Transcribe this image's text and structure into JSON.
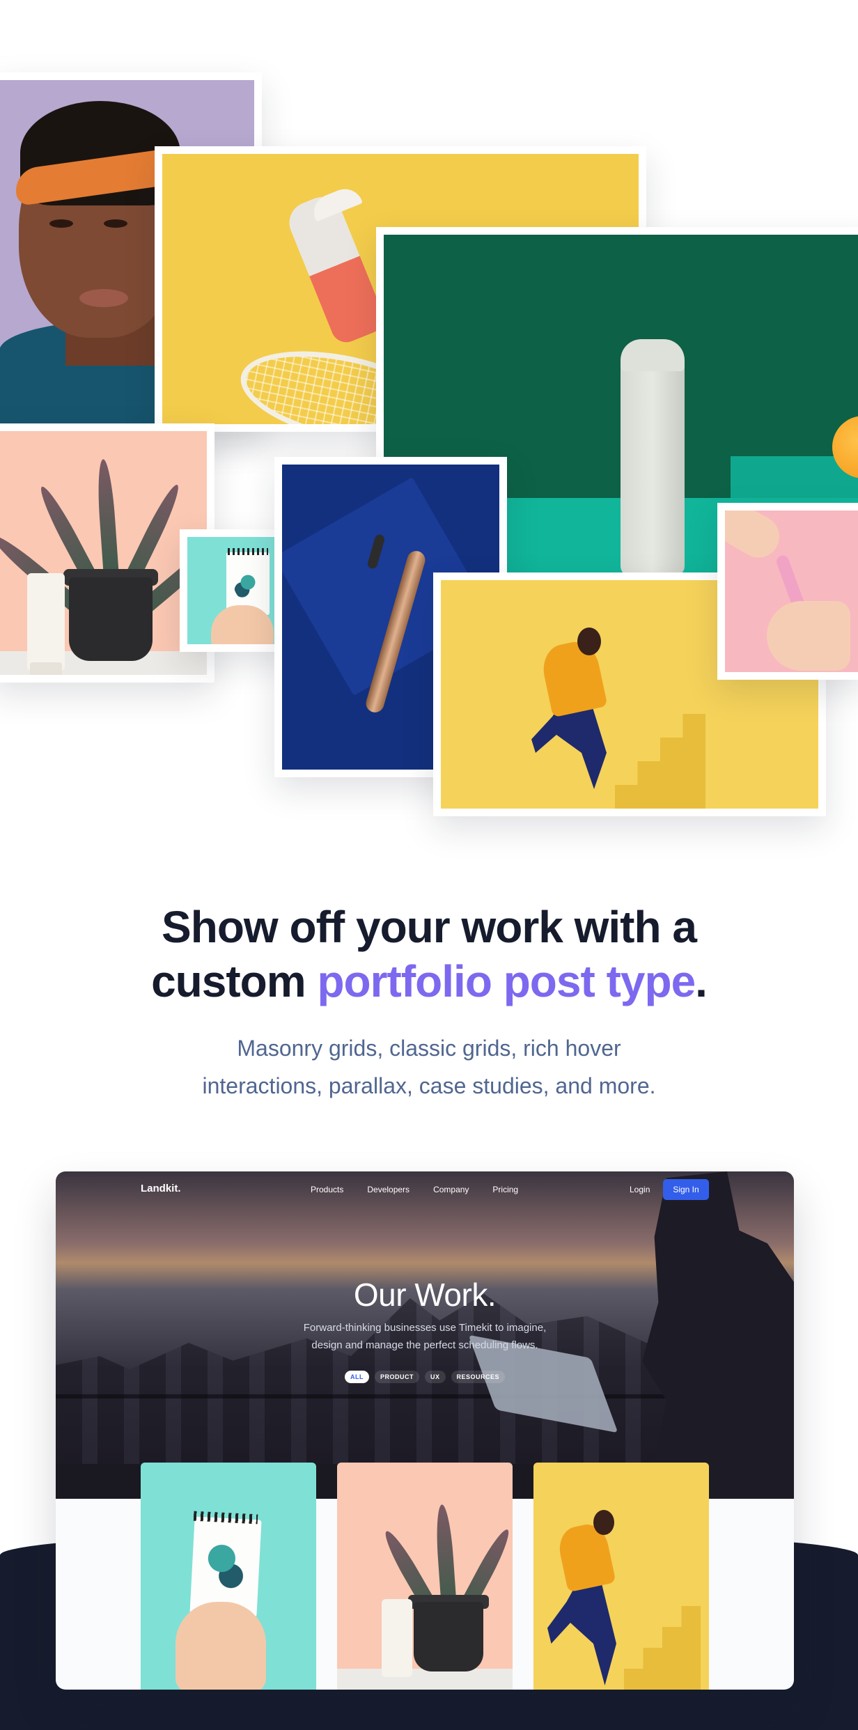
{
  "collage": {
    "images": [
      {
        "name": "portrait-headband",
        "depicts": "man-with-orange-headband"
      },
      {
        "name": "bottle-yellow",
        "depicts": "bottle-and-racket"
      },
      {
        "name": "bottle-green",
        "depicts": "bottle-on-green"
      },
      {
        "name": "plant-cream",
        "depicts": "plant-and-tube"
      },
      {
        "name": "notebook",
        "depicts": "notebook-in-hand"
      },
      {
        "name": "toothbrush-navy",
        "depicts": "toothbrush"
      },
      {
        "name": "runner-yellow",
        "depicts": "runner-on-stairs"
      },
      {
        "name": "toothbrush-pink",
        "depicts": "pink-toothbrush"
      }
    ]
  },
  "headline": {
    "line1": "Show off your work with a",
    "line2_start": "custom ",
    "accent": "portfolio post type",
    "end": "."
  },
  "lead": {
    "line1": "Masonry grids, classic grids, rich hover",
    "line2": "interactions, parallax, case studies, and more."
  },
  "preview": {
    "brand": "Landkit.",
    "nav": [
      "Products",
      "Developers",
      "Company",
      "Pricing"
    ],
    "login": "Login",
    "signin": "Sign In",
    "title": "Our Work.",
    "subtitle_line1": "Forward-thinking businesses use Timekit to imagine,",
    "subtitle_line2": "design and manage the perfect scheduling flows.",
    "filters": [
      "ALL",
      "PRODUCT",
      "UX",
      "RESOURCES"
    ],
    "active_filter": "ALL"
  },
  "colors": {
    "accent": "#7c69ef",
    "heading": "#161c2d",
    "lead": "#506690",
    "primary_button": "#335eea",
    "dark_band": "#161c2d"
  }
}
